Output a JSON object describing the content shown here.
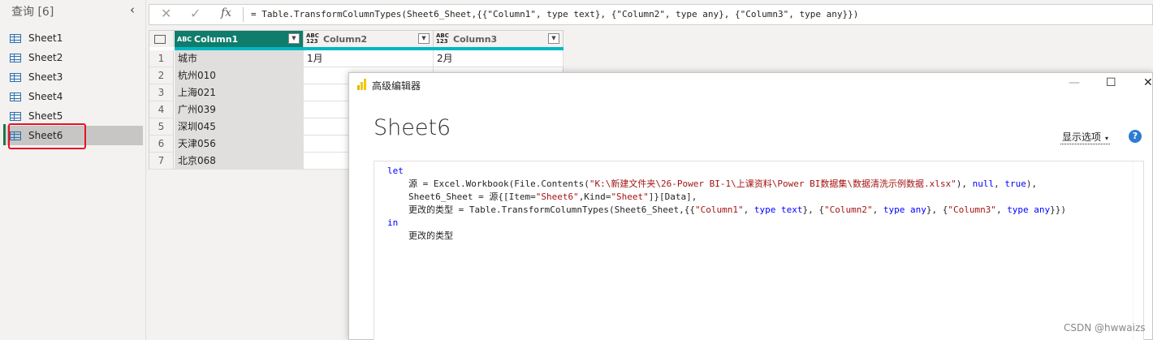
{
  "queries": {
    "header": "查询 [6]",
    "collapse_icon": "‹",
    "items": [
      {
        "label": "Sheet1"
      },
      {
        "label": "Sheet2"
      },
      {
        "label": "Sheet3"
      },
      {
        "label": "Sheet4"
      },
      {
        "label": "Sheet5"
      },
      {
        "label": "Sheet6",
        "selected": true
      }
    ],
    "highlight_color": "#e81123"
  },
  "formula_bar": {
    "cancel_glyph": "✕",
    "commit_glyph": "✓",
    "fx_glyph": "fx",
    "formula": "= Table.TransformColumnTypes(Sheet6_Sheet,{{\"Column1\", type text}, {\"Column2\", type any}, {\"Column3\", type any}})"
  },
  "grid": {
    "columns": [
      {
        "type": "ABC",
        "name": "Column1",
        "active": true
      },
      {
        "type": "ABC 123",
        "name": "Column2"
      },
      {
        "type": "ABC 123",
        "name": "Column3"
      }
    ],
    "rows": [
      {
        "n": "1",
        "c1": "城市",
        "c2": "1月",
        "c3": "2月"
      },
      {
        "n": "2",
        "c1": "杭州010",
        "c2": "",
        "c3": ""
      },
      {
        "n": "3",
        "c1": "上海021",
        "c2": "",
        "c3": ""
      },
      {
        "n": "4",
        "c1": "广州039",
        "c2": "",
        "c3": ""
      },
      {
        "n": "5",
        "c1": "深圳045",
        "c2": "",
        "c3": ""
      },
      {
        "n": "6",
        "c1": "天津056",
        "c2": "",
        "c3": ""
      },
      {
        "n": "7",
        "c1": "北京068",
        "c2": "",
        "c3": ""
      }
    ],
    "accent_color": "#107c6b"
  },
  "dialog": {
    "title": "高级编辑器",
    "minimize_glyph": "—",
    "maximize_glyph": "☐",
    "close_glyph": "✕",
    "query_name": "Sheet6",
    "display_options": "显示选项",
    "display_options_chevron": "▾",
    "help_glyph": "?",
    "code": {
      "l1_kw": "let",
      "l2_a": "源 = Excel.Workbook(File.Contents(",
      "l2_str": "\"K:\\新建文件夹\\26-Power BI-1\\上课资料\\Power BI数据集\\数据清洗示例数据.xlsx\"",
      "l2_b": "), ",
      "l2_null": "null",
      "l2_c": ", ",
      "l2_true": "true",
      "l2_d": "),",
      "l3_a": "Sheet6_Sheet = 源{[Item=",
      "l3_s1": "\"Sheet6\"",
      "l3_b": ",Kind=",
      "l3_s2": "\"Sheet\"",
      "l3_c": "]}[Data],",
      "l4_a": "更改的类型 = Table.TransformColumnTypes(Sheet6_Sheet,{{",
      "l4_s1": "\"Column1\"",
      "l4_b": ", ",
      "l4_k1": "type text",
      "l4_c": "}, {",
      "l4_s2": "\"Column2\"",
      "l4_d": ", ",
      "l4_k2": "type any",
      "l4_e": "}, {",
      "l4_s3": "\"Column3\"",
      "l4_f": ", ",
      "l4_k3": "type any",
      "l4_g": "}})",
      "l5_kw": "in",
      "l6": "更改的类型"
    }
  },
  "watermark": "CSDN @hwwaizs"
}
